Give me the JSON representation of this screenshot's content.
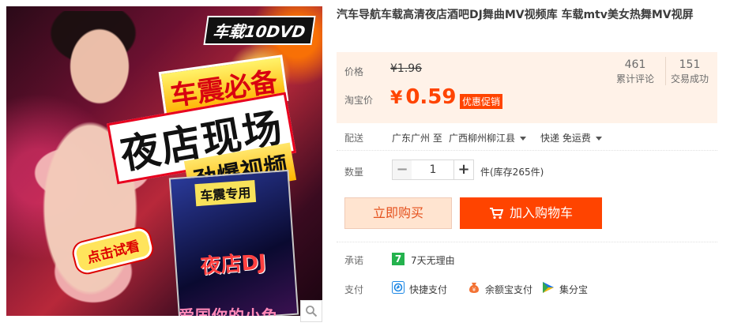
{
  "image": {
    "badge": "车载10DVD",
    "slogan": "车震必备",
    "headline": "夜店现场",
    "subline": "劲爆视频",
    "dvd_label": "车震专用",
    "dvd_title": "夜店DJ",
    "trial_tag": "点击试看",
    "bottom_text": "爱国你的小兔"
  },
  "title": "汽车导航车载高清夜店酒吧DJ舞曲MV视频库 车载mtv美女热舞MV视屏",
  "price": {
    "label": "价格",
    "original": "¥1.96",
    "taobao_label": "淘宝价",
    "currency": "¥",
    "value": "0.59",
    "promo": "优惠促销"
  },
  "stats": {
    "reviews_count": "461",
    "reviews_label": "累计评论",
    "sales_count": "151",
    "sales_label": "交易成功"
  },
  "shipping": {
    "label": "配送",
    "from": "广东广州 至",
    "to": "广西柳州柳江县",
    "method": "快递 免运费"
  },
  "quantity": {
    "label": "数量",
    "minus": "−",
    "value": "1",
    "plus": "+",
    "stock": "件(库存265件)"
  },
  "actions": {
    "buy_now": "立即购买",
    "add_cart": "加入购物车"
  },
  "promise": {
    "label": "承诺",
    "icon": "7",
    "text": "7天无理由"
  },
  "payment": {
    "label": "支付",
    "methods": [
      "快捷支付",
      "余额宝支付",
      "集分宝"
    ]
  },
  "colors": {
    "accent": "#ff4400",
    "price_bg": "#fff2e8",
    "buy_now_bg": "#ffe4d0",
    "promise_green": "#24b24d"
  }
}
